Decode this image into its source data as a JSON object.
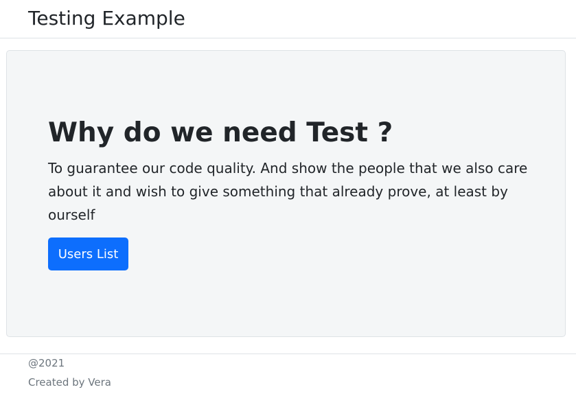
{
  "navbar": {
    "brand": "Testing Example"
  },
  "hero": {
    "title": "Why do we need Test ?",
    "text": "To guarantee our code quality. And show the people that we also care about it and wish to give something that already prove, at least by ourself",
    "button_label": "Users List"
  },
  "footer": {
    "year": "@2021",
    "credit": "Created by Vera"
  },
  "colors": {
    "primary": "#0d6efd",
    "hero_background": "#f4f6f7",
    "text": "#212529",
    "muted": "#6c757d"
  }
}
